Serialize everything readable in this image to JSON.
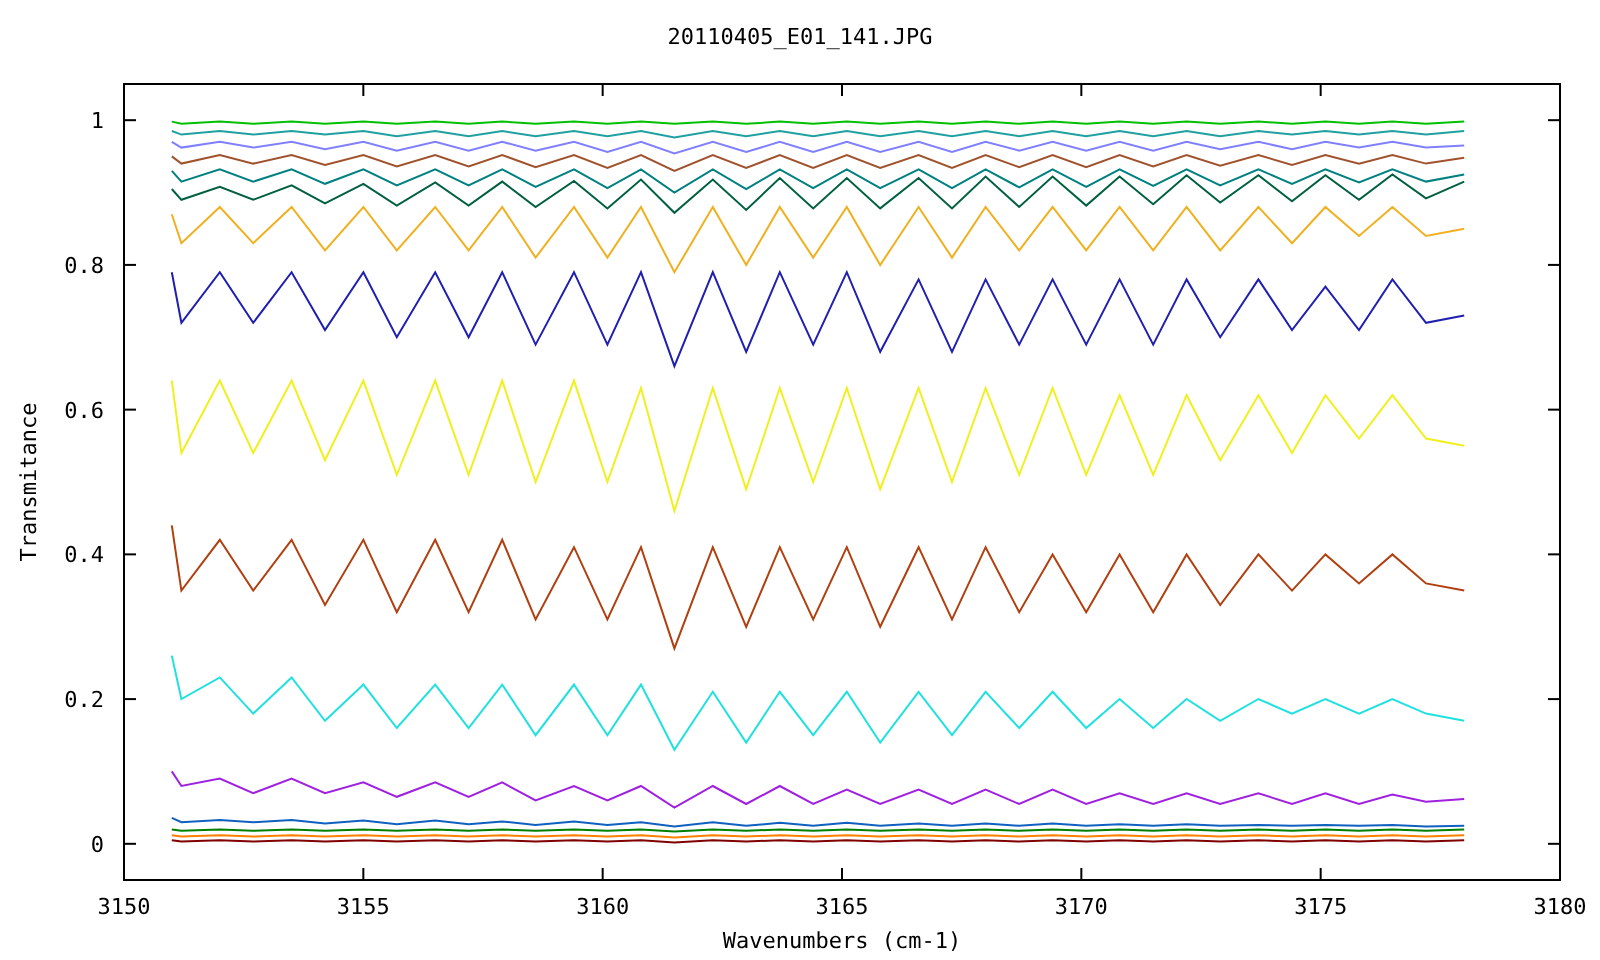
{
  "chart": {
    "chart_data": {
      "type": "line",
      "title": "20110405_E01_141.JPG",
      "xlabel": "Wavenumbers (cm-1)",
      "ylabel": "Transmitance",
      "x": [
        3151.0,
        3151.2,
        3152.0,
        3152.7,
        3153.5,
        3154.2,
        3155.0,
        3155.7,
        3156.5,
        3157.2,
        3157.9,
        3158.6,
        3159.4,
        3160.1,
        3160.8,
        3161.5,
        3162.3,
        3163.0,
        3163.7,
        3164.4,
        3165.1,
        3165.8,
        3166.6,
        3167.3,
        3168.0,
        3168.7,
        3169.4,
        3170.1,
        3170.8,
        3171.5,
        3172.2,
        3172.9,
        3173.7,
        3174.4,
        3175.1,
        3175.8,
        3176.5,
        3177.2,
        3178.0
      ],
      "xlim": [
        3150,
        3180
      ],
      "ylim": [
        -0.05,
        1.05
      ],
      "xticks": [
        3150,
        3155,
        3160,
        3165,
        3170,
        3175,
        3180
      ],
      "yticks": [
        0,
        0.2,
        0.4,
        0.6,
        0.8,
        1
      ],
      "series": [
        {
          "color": "#00c000",
          "values": [
            0.998,
            0.995,
            0.998,
            0.995,
            0.998,
            0.995,
            0.998,
            0.995,
            0.998,
            0.995,
            0.998,
            0.995,
            0.998,
            0.995,
            0.998,
            0.995,
            0.998,
            0.995,
            0.998,
            0.995,
            0.998,
            0.995,
            0.998,
            0.995,
            0.998,
            0.995,
            0.998,
            0.995,
            0.998,
            0.995,
            0.998,
            0.995,
            0.998,
            0.995,
            0.998,
            0.995,
            0.998,
            0.995,
            0.998
          ]
        },
        {
          "color": "#20a0a0",
          "values": [
            0.985,
            0.98,
            0.985,
            0.98,
            0.985,
            0.98,
            0.985,
            0.978,
            0.985,
            0.978,
            0.985,
            0.978,
            0.985,
            0.978,
            0.985,
            0.976,
            0.985,
            0.978,
            0.985,
            0.978,
            0.985,
            0.978,
            0.985,
            0.978,
            0.985,
            0.978,
            0.985,
            0.978,
            0.985,
            0.978,
            0.985,
            0.978,
            0.985,
            0.98,
            0.985,
            0.98,
            0.985,
            0.98,
            0.985
          ]
        },
        {
          "color": "#8080ff",
          "values": [
            0.97,
            0.962,
            0.97,
            0.962,
            0.97,
            0.96,
            0.97,
            0.958,
            0.97,
            0.958,
            0.97,
            0.958,
            0.97,
            0.956,
            0.97,
            0.954,
            0.97,
            0.956,
            0.97,
            0.956,
            0.97,
            0.956,
            0.97,
            0.956,
            0.97,
            0.958,
            0.97,
            0.958,
            0.97,
            0.958,
            0.97,
            0.96,
            0.97,
            0.96,
            0.97,
            0.962,
            0.97,
            0.962,
            0.965
          ]
        },
        {
          "color": "#a0522d",
          "values": [
            0.95,
            0.94,
            0.952,
            0.94,
            0.952,
            0.938,
            0.952,
            0.936,
            0.952,
            0.936,
            0.952,
            0.935,
            0.952,
            0.934,
            0.952,
            0.93,
            0.952,
            0.934,
            0.952,
            0.934,
            0.952,
            0.934,
            0.952,
            0.934,
            0.952,
            0.935,
            0.952,
            0.935,
            0.952,
            0.936,
            0.952,
            0.937,
            0.952,
            0.938,
            0.952,
            0.94,
            0.952,
            0.94,
            0.948
          ]
        },
        {
          "color": "#008080",
          "values": [
            0.93,
            0.915,
            0.932,
            0.915,
            0.932,
            0.912,
            0.932,
            0.91,
            0.932,
            0.91,
            0.932,
            0.908,
            0.932,
            0.906,
            0.932,
            0.9,
            0.932,
            0.905,
            0.932,
            0.906,
            0.932,
            0.906,
            0.932,
            0.906,
            0.932,
            0.907,
            0.932,
            0.908,
            0.932,
            0.909,
            0.932,
            0.91,
            0.932,
            0.912,
            0.932,
            0.914,
            0.932,
            0.915,
            0.925
          ]
        },
        {
          "color": "#006040",
          "values": [
            0.905,
            0.89,
            0.908,
            0.89,
            0.91,
            0.885,
            0.912,
            0.882,
            0.914,
            0.882,
            0.915,
            0.88,
            0.916,
            0.878,
            0.918,
            0.872,
            0.918,
            0.876,
            0.92,
            0.878,
            0.92,
            0.878,
            0.92,
            0.878,
            0.922,
            0.88,
            0.922,
            0.882,
            0.922,
            0.884,
            0.924,
            0.886,
            0.924,
            0.888,
            0.924,
            0.89,
            0.925,
            0.892,
            0.915
          ]
        },
        {
          "color": "#f0b020",
          "values": [
            0.87,
            0.83,
            0.88,
            0.83,
            0.88,
            0.82,
            0.88,
            0.82,
            0.88,
            0.82,
            0.88,
            0.81,
            0.88,
            0.81,
            0.88,
            0.79,
            0.88,
            0.8,
            0.88,
            0.81,
            0.88,
            0.8,
            0.88,
            0.81,
            0.88,
            0.82,
            0.88,
            0.82,
            0.88,
            0.82,
            0.88,
            0.82,
            0.88,
            0.83,
            0.88,
            0.84,
            0.88,
            0.84,
            0.85
          ]
        },
        {
          "color": "#2020b0",
          "values": [
            0.79,
            0.72,
            0.79,
            0.72,
            0.79,
            0.71,
            0.79,
            0.7,
            0.79,
            0.7,
            0.79,
            0.69,
            0.79,
            0.69,
            0.79,
            0.66,
            0.79,
            0.68,
            0.79,
            0.69,
            0.79,
            0.68,
            0.78,
            0.68,
            0.78,
            0.69,
            0.78,
            0.69,
            0.78,
            0.69,
            0.78,
            0.7,
            0.78,
            0.71,
            0.77,
            0.71,
            0.78,
            0.72,
            0.73
          ]
        },
        {
          "color": "#f0f020",
          "values": [
            0.64,
            0.54,
            0.64,
            0.54,
            0.64,
            0.53,
            0.64,
            0.51,
            0.64,
            0.51,
            0.64,
            0.5,
            0.64,
            0.5,
            0.63,
            0.46,
            0.63,
            0.49,
            0.63,
            0.5,
            0.63,
            0.49,
            0.63,
            0.5,
            0.63,
            0.51,
            0.63,
            0.51,
            0.62,
            0.51,
            0.62,
            0.53,
            0.62,
            0.54,
            0.62,
            0.56,
            0.62,
            0.56,
            0.55
          ]
        },
        {
          "color": "#b04010",
          "values": [
            0.44,
            0.35,
            0.42,
            0.35,
            0.42,
            0.33,
            0.42,
            0.32,
            0.42,
            0.32,
            0.42,
            0.31,
            0.41,
            0.31,
            0.41,
            0.27,
            0.41,
            0.3,
            0.41,
            0.31,
            0.41,
            0.3,
            0.41,
            0.31,
            0.41,
            0.32,
            0.4,
            0.32,
            0.4,
            0.32,
            0.4,
            0.33,
            0.4,
            0.35,
            0.4,
            0.36,
            0.4,
            0.36,
            0.35
          ]
        },
        {
          "color": "#20e0e0",
          "values": [
            0.26,
            0.2,
            0.23,
            0.18,
            0.23,
            0.17,
            0.22,
            0.16,
            0.22,
            0.16,
            0.22,
            0.15,
            0.22,
            0.15,
            0.22,
            0.13,
            0.21,
            0.14,
            0.21,
            0.15,
            0.21,
            0.14,
            0.21,
            0.15,
            0.21,
            0.16,
            0.21,
            0.16,
            0.2,
            0.16,
            0.2,
            0.17,
            0.2,
            0.18,
            0.2,
            0.18,
            0.2,
            0.18,
            0.17
          ]
        },
        {
          "color": "#a020e0",
          "values": [
            0.1,
            0.08,
            0.09,
            0.07,
            0.09,
            0.07,
            0.085,
            0.065,
            0.085,
            0.065,
            0.085,
            0.06,
            0.08,
            0.06,
            0.08,
            0.05,
            0.08,
            0.055,
            0.08,
            0.055,
            0.075,
            0.055,
            0.075,
            0.055,
            0.075,
            0.055,
            0.075,
            0.055,
            0.07,
            0.055,
            0.07,
            0.055,
            0.07,
            0.055,
            0.07,
            0.055,
            0.068,
            0.058,
            0.062
          ]
        },
        {
          "color": "#1060c0",
          "values": [
            0.036,
            0.03,
            0.033,
            0.03,
            0.033,
            0.028,
            0.032,
            0.027,
            0.032,
            0.027,
            0.031,
            0.026,
            0.031,
            0.026,
            0.03,
            0.024,
            0.03,
            0.025,
            0.029,
            0.025,
            0.029,
            0.025,
            0.028,
            0.025,
            0.028,
            0.025,
            0.028,
            0.025,
            0.027,
            0.025,
            0.027,
            0.025,
            0.026,
            0.025,
            0.026,
            0.025,
            0.026,
            0.024,
            0.025
          ]
        },
        {
          "color": "#008000",
          "values": [
            0.02,
            0.018,
            0.02,
            0.018,
            0.02,
            0.018,
            0.02,
            0.018,
            0.02,
            0.018,
            0.02,
            0.018,
            0.02,
            0.018,
            0.02,
            0.017,
            0.02,
            0.018,
            0.02,
            0.018,
            0.02,
            0.018,
            0.02,
            0.018,
            0.02,
            0.018,
            0.02,
            0.018,
            0.02,
            0.018,
            0.02,
            0.018,
            0.02,
            0.018,
            0.02,
            0.018,
            0.02,
            0.018,
            0.02
          ]
        },
        {
          "color": "#ff8000",
          "values": [
            0.012,
            0.01,
            0.012,
            0.01,
            0.012,
            0.01,
            0.012,
            0.01,
            0.012,
            0.01,
            0.012,
            0.01,
            0.012,
            0.01,
            0.012,
            0.009,
            0.012,
            0.01,
            0.012,
            0.01,
            0.012,
            0.01,
            0.012,
            0.01,
            0.012,
            0.01,
            0.012,
            0.01,
            0.012,
            0.01,
            0.012,
            0.01,
            0.012,
            0.01,
            0.012,
            0.01,
            0.012,
            0.01,
            0.012
          ]
        },
        {
          "color": "#800000",
          "values": [
            0.005,
            0.003,
            0.005,
            0.003,
            0.005,
            0.003,
            0.005,
            0.003,
            0.005,
            0.003,
            0.005,
            0.003,
            0.005,
            0.003,
            0.005,
            0.002,
            0.005,
            0.003,
            0.005,
            0.003,
            0.005,
            0.003,
            0.005,
            0.003,
            0.005,
            0.003,
            0.005,
            0.003,
            0.005,
            0.003,
            0.005,
            0.003,
            0.005,
            0.003,
            0.005,
            0.003,
            0.005,
            0.003,
            0.005
          ]
        }
      ]
    }
  }
}
